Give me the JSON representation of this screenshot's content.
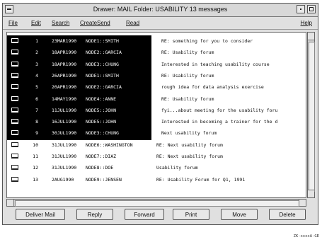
{
  "window": {
    "title": "Drawer: MAIL Folder: USABILITY 13 messages"
  },
  "menu": {
    "file": "File",
    "edit": "Edit",
    "search": "Search",
    "createsend": "CreateSend",
    "read": "Read",
    "help": "Help"
  },
  "messages": [
    {
      "num": "1",
      "date": "23MAR1990",
      "from": "NODE1::SMITH",
      "subject": "RE: something for you to consider",
      "selected": true
    },
    {
      "num": "2",
      "date": "18APR1990",
      "from": "NODE2::GARCIA",
      "subject": "RE: Usability forum",
      "selected": true
    },
    {
      "num": "3",
      "date": "18APR1990",
      "from": "NODE3::CHUNG",
      "subject": "Interested in teaching usability course",
      "selected": true
    },
    {
      "num": "4",
      "date": "26APR1990",
      "from": "NODE1::SMITH",
      "subject": "RE: Usability forum",
      "selected": true
    },
    {
      "num": "5",
      "date": "20APR1990",
      "from": "NODE2::GARCIA",
      "subject": "rough idea for data analysis exercise",
      "selected": true
    },
    {
      "num": "6",
      "date": "14MAY1990",
      "from": "NODE4::ANNE",
      "subject": "RE: Usability forum",
      "selected": true
    },
    {
      "num": "7",
      "date": "11JUL1990",
      "from": "NODE5::JOHN",
      "subject": "fyi...about meeting for the usability foru",
      "selected": true
    },
    {
      "num": "8",
      "date": "16JUL1990",
      "from": "NODE5::JOHN",
      "subject": "Interested in becoming a trainer for the d",
      "selected": true
    },
    {
      "num": "9",
      "date": "30JUL1990",
      "from": "NODE3::CHUNG",
      "subject": "Next usability forum",
      "selected": true
    },
    {
      "num": "10",
      "date": "31JUL1990",
      "from": "NODE6::WASHINGTON",
      "subject": "RE: Next usability forum",
      "selected": false
    },
    {
      "num": "11",
      "date": "31JUL1990",
      "from": "NODE7::DIAZ",
      "subject": "RE: Next usability forum",
      "selected": false
    },
    {
      "num": "12",
      "date": "31JUL1990",
      "from": "NODE8::DOE",
      "subject": "Usability forum",
      "selected": false
    },
    {
      "num": "13",
      "date": "2AUG1990",
      "from": "NODE9::JENSEN",
      "subject": "RE: Usability Forum for Q1, 1991",
      "selected": false
    }
  ],
  "buttons": {
    "deliver_mail": "Deliver Mail",
    "reply": "Reply",
    "forward": "Forward",
    "print": "Print",
    "move": "Move",
    "delete": "Delete"
  },
  "figure_id": "ZK-xxxxA-GE"
}
